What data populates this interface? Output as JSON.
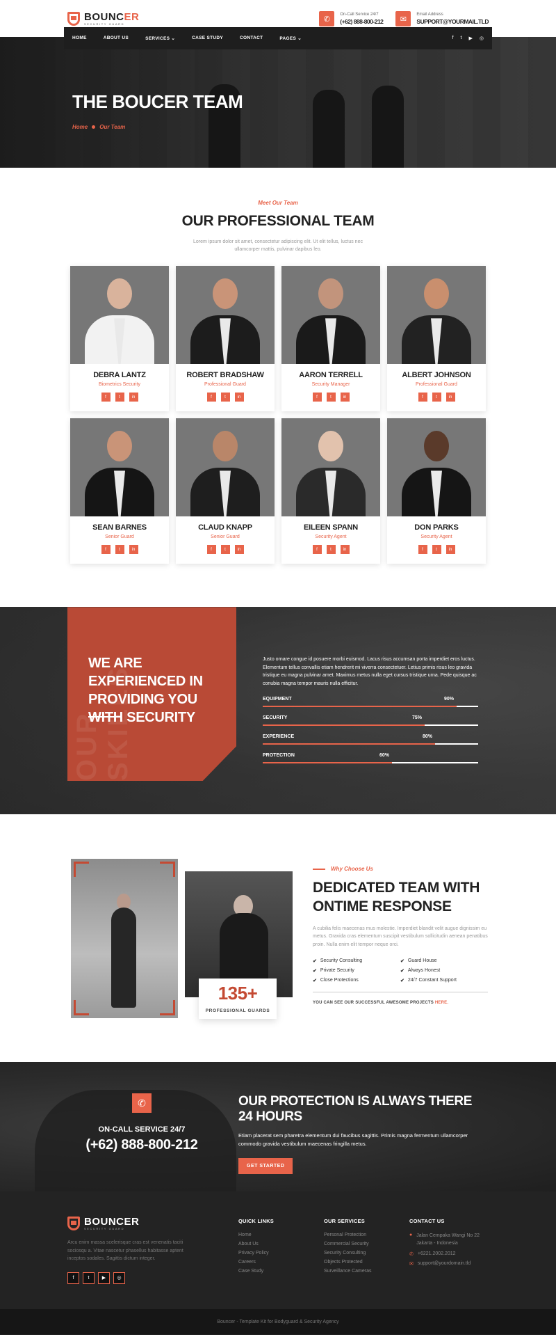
{
  "brand": {
    "name_main": "BOUNC",
    "name_accent": "ER",
    "tagline": "SECURITY GUARD"
  },
  "contacts": [
    {
      "icon": "phone-icon",
      "label": "On-Call Service 24/7",
      "value": "(+62) 888-800-212"
    },
    {
      "icon": "mail-icon",
      "label": "Email Address",
      "value": "SUPPORT@YOURMAIL.TLD"
    }
  ],
  "nav": {
    "items": [
      "HOME",
      "ABOUT US",
      "SERVICES ⌄",
      "CASE STUDY",
      "CONTACT",
      "PAGES ⌄"
    ],
    "socials": [
      "f",
      "t",
      "▶",
      "◎"
    ]
  },
  "hero": {
    "title": "THE BOUCER TEAM",
    "crumb_home": "Home",
    "crumb_current": "Our Team"
  },
  "team_section": {
    "kicker": "Meet Our Team",
    "title": "OUR PROFESSIONAL TEAM",
    "description": "Lorem ipsum dolor sit amet, consectetur adipiscing elit. Ut elit tellus, luctus nec ullamcorper mattis, pulvinar dapibus leo.",
    "members": [
      {
        "name": "DEBRA LANTZ",
        "role": "Biometrics Security",
        "skin": "#d9b39c",
        "suit": "#f2f2f2"
      },
      {
        "name": "ROBERT BRADSHAW",
        "role": "Professional Guard",
        "skin": "#c99478",
        "suit": "#1c1c1c"
      },
      {
        "name": "AARON TERRELL",
        "role": "Security Manager",
        "skin": "#c2947c",
        "suit": "#1a1a1a"
      },
      {
        "name": "ALBERT JOHNSON",
        "role": "Professional Guard",
        "skin": "#c98f6e",
        "suit": "#222"
      },
      {
        "name": "SEAN BARNES",
        "role": "Senior Guard",
        "skin": "#c99478",
        "suit": "#151515"
      },
      {
        "name": "CLAUD KNAPP",
        "role": "Senior Guard",
        "skin": "#b98669",
        "suit": "#1e1e1e"
      },
      {
        "name": "EILEEN SPANN",
        "role": "Security Agent",
        "skin": "#e2c2ad",
        "suit": "#2a2a2a"
      },
      {
        "name": "DON PARKS",
        "role": "Security Agent",
        "skin": "#5a3a2a",
        "suit": "#151515"
      }
    ],
    "social_labels": [
      "f",
      "t",
      "in"
    ]
  },
  "experience": {
    "watermark": "OUR SKILLS",
    "title": "WE ARE EXPERIENCED IN PROVIDING YOU WITH SECURITY",
    "text": "Justo ornare congue id posuere morbi euismod. Lacus risus accumsan porta imperdiet eros luctus. Elementum tellus convallis etiam hendrerit mi viverra consectetuer. Letius primis risus leo gravida tristique eu magna pulvinar amet. Maximus metus nulla eget cursus tristique urna. Pede quisque ac conubia magna tempor mauris nulla efficitur.",
    "skills": [
      {
        "name": "EQUIPMENT",
        "percent": 90,
        "label": "90%"
      },
      {
        "name": "SECURITY",
        "percent": 75,
        "label": "75%"
      },
      {
        "name": "EXPERIENCE",
        "percent": 80,
        "label": "80%"
      },
      {
        "name": "PROTECTION",
        "percent": 60,
        "label": "60%"
      }
    ]
  },
  "why": {
    "kicker": "Why Choose Us",
    "title": "DEDICATED TEAM WITH ONTIME RESPONSE",
    "description": "A cubilia felis maecenas mus molestie. Imperdiet blandit velit augue dignissim eu metus. Gravida cras elementum suscipit vestibulum sollicitudin aenean penatibus proin. Nulla enim elit tempor neque orci.",
    "stat_number": "135+",
    "stat_label": "PROFESSIONAL GUARDS",
    "features": [
      "Security Consulting",
      "Guard House",
      "Private Security",
      "Always Honest",
      "Close Protections",
      "24/7 Constant Support"
    ],
    "link_text": "YOU CAN SEE OUR SUCCESSFUL AWESOME PROJECTS",
    "link_here": "HERE."
  },
  "cta": {
    "service_label": "ON-CALL SERVICE 24/7",
    "phone": "(+62) 888-800-212",
    "title": "OUR PROTECTION IS ALWAYS THERE 24 HOURS",
    "text": "Etiam placerat sem pharetra elementum dui faucibus sagittis. Primis magna fermentum ullamcorper commodo gravida vestibulum maecenas fringilla metus.",
    "button": "GET STARTED"
  },
  "footer": {
    "description": "Arcu enim massa scelerisque cras est venenatis taciti sociosqu a. Vitae nascetur phasellus habitasse aptent inceptos sodales. Sagittis dictum integer.",
    "socials": [
      "f",
      "t",
      "▶",
      "◎"
    ],
    "quick_links_title": "QUICK LINKS",
    "quick_links": [
      "Home",
      "About Us",
      "Privacy Policy",
      "Careers",
      "Case Study"
    ],
    "services_title": "OUR SERVICES",
    "services": [
      "Personal Protection",
      "Commercial Security",
      "Security Consulting",
      "Objects Protected",
      "Surveillance Cameras"
    ],
    "contact_title": "CONTACT US",
    "address": "Jalan Cempaka Wangi No 22 Jakarta - Indonesia",
    "phone": "+6221.2002.2012",
    "email": "support@yourdomain.tld",
    "copyright": "Bouncer - Template Kit for Bodyguard & Security Agency"
  }
}
